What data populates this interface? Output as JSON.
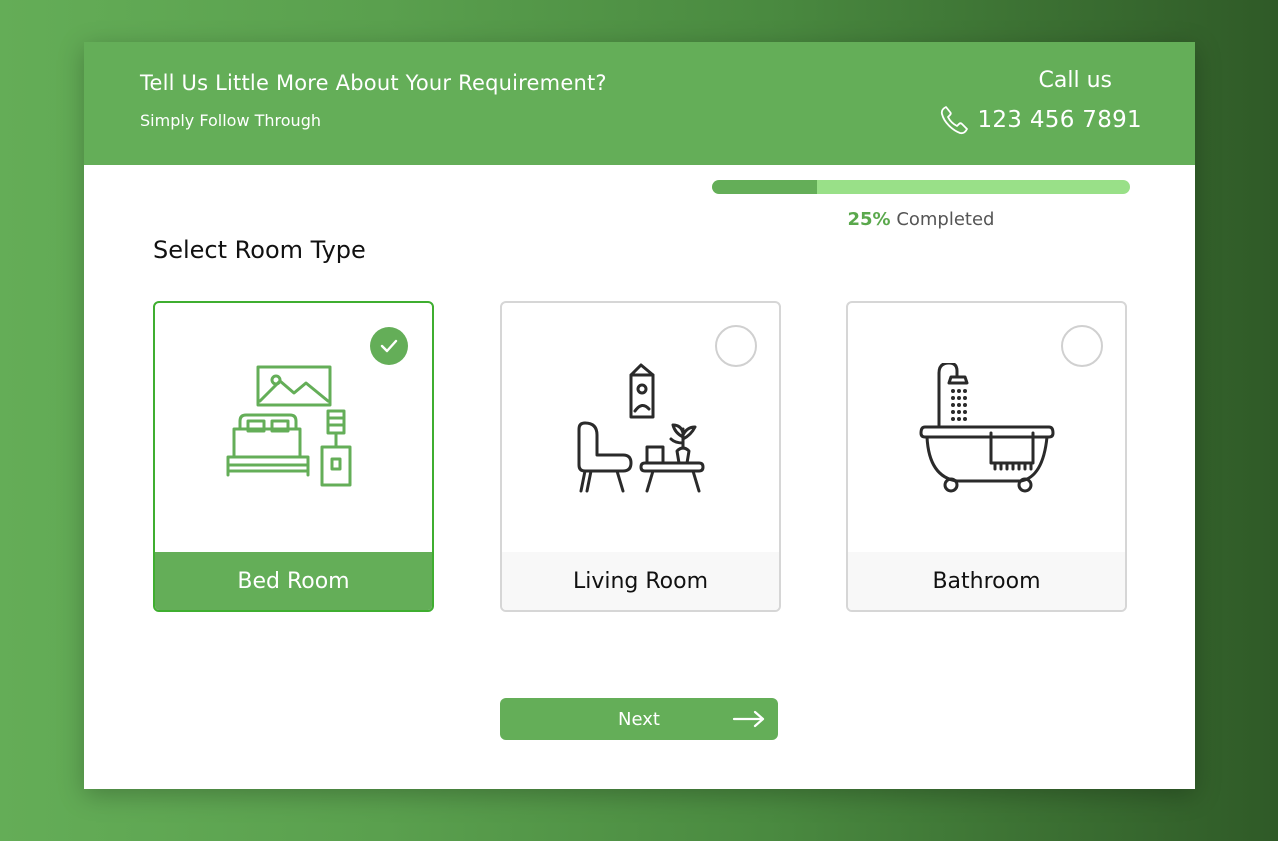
{
  "header": {
    "title": "Tell Us Little More About Your Requirement?",
    "subtitle": "Simply Follow Through",
    "call_label": "Call us",
    "phone_icon": "phone-icon",
    "phone_number": "123 456 7891"
  },
  "progress": {
    "percent": 25,
    "percent_label": "25%",
    "status_label": "Completed"
  },
  "section": {
    "title": "Select Room Type"
  },
  "rooms": [
    {
      "label": "Bed Room",
      "icon": "bedroom-icon",
      "selected": true
    },
    {
      "label": "Living Room",
      "icon": "living-room-icon",
      "selected": false
    },
    {
      "label": "Bathroom",
      "icon": "bathroom-icon",
      "selected": false
    }
  ],
  "actions": {
    "next_label": "Next",
    "next_icon": "arrow-right-icon"
  },
  "colors": {
    "brand_green": "#64ae58",
    "progress_track": "#99e088",
    "selected_border": "#3fae30"
  }
}
